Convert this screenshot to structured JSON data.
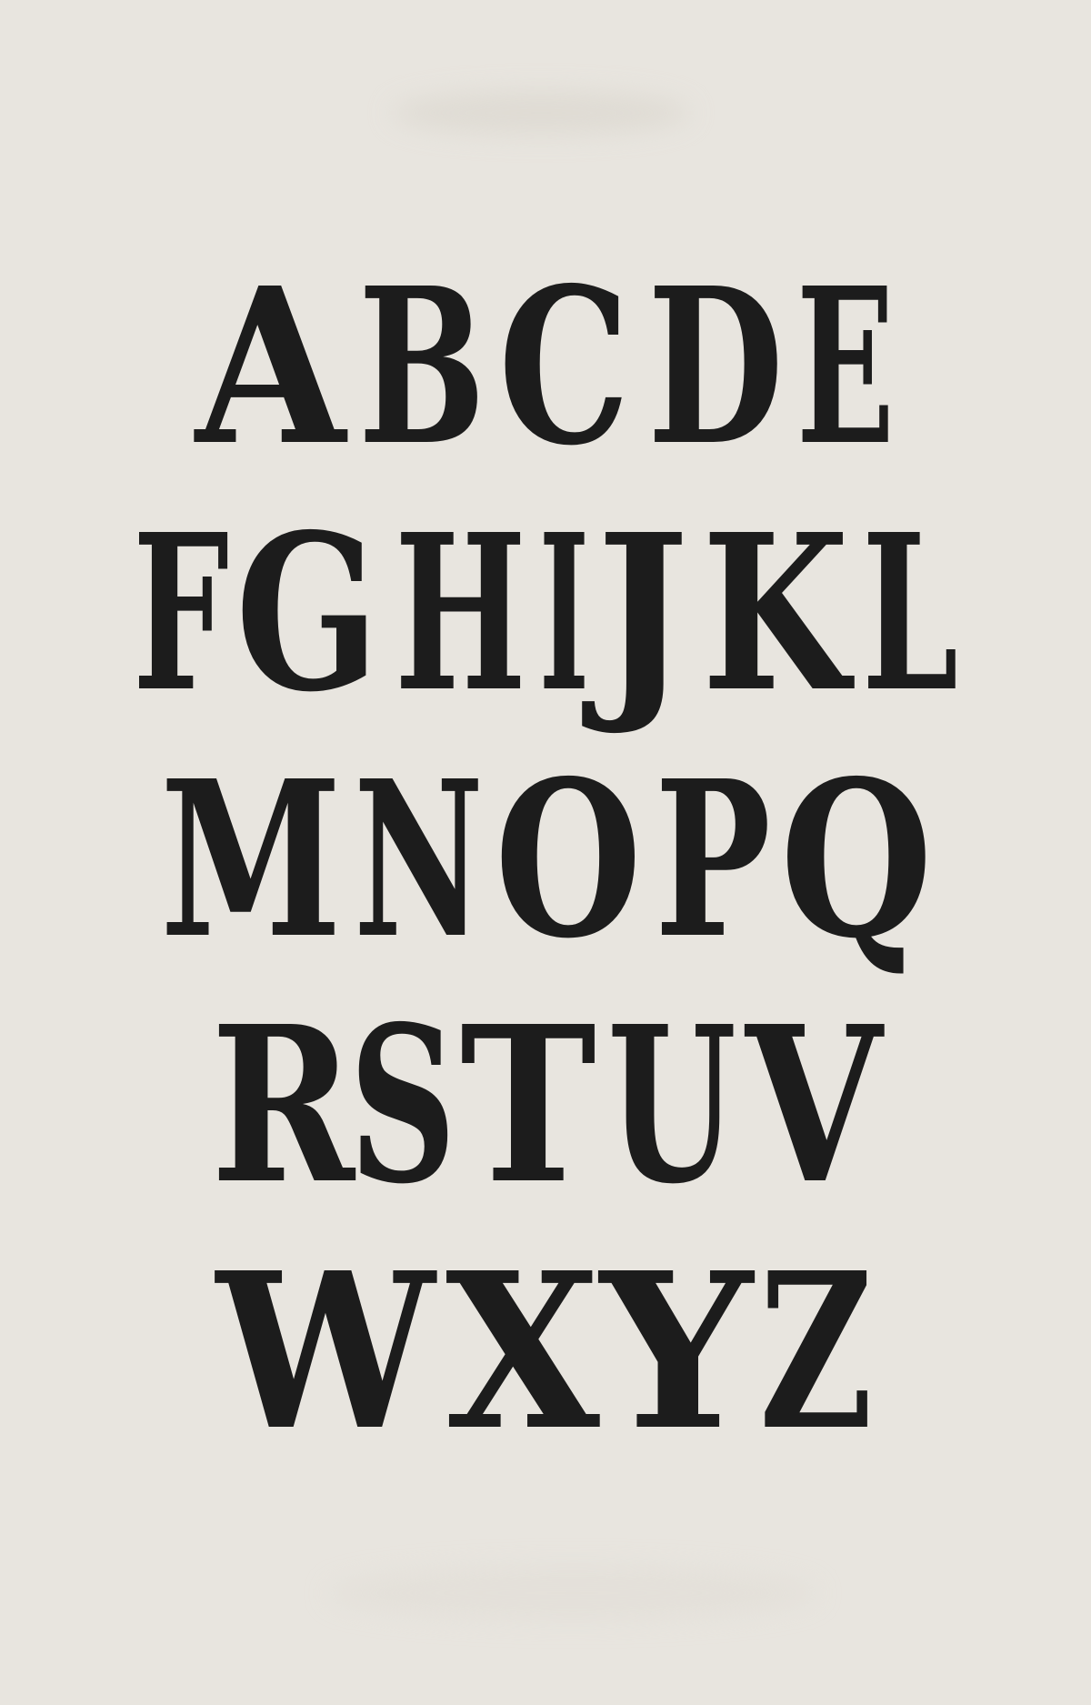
{
  "specimen": {
    "background": "#e8e5df",
    "ink": "#1c1c1c",
    "rows": [
      [
        "A",
        "B",
        "C",
        "D",
        "E"
      ],
      [
        "F",
        "G",
        "H",
        "I",
        "J",
        "K",
        "L"
      ],
      [
        "M",
        "N",
        "O",
        "P",
        "Q"
      ],
      [
        "R",
        "S",
        "T",
        "U",
        "V"
      ],
      [
        "W",
        "X",
        "Y",
        "Z"
      ]
    ]
  }
}
